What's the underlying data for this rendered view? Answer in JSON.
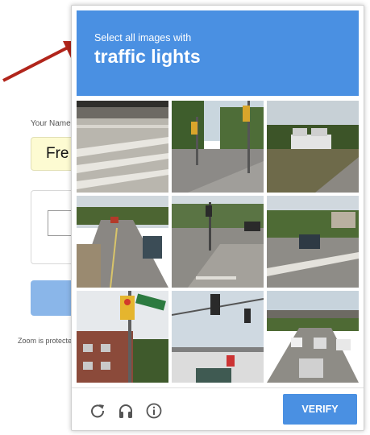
{
  "background_form": {
    "name_label": "Your Name",
    "name_value": "Fre",
    "zoom_text": "Zoom is protected"
  },
  "captcha": {
    "instruction": "Select all images with",
    "target": "traffic lights",
    "verify_label": "VERIFY",
    "footer_icons": [
      "reload-icon",
      "headphones-icon",
      "info-icon"
    ],
    "tiles": [
      "crosswalk street",
      "intersection with traffic light",
      "car carrier truck on highway",
      "road with car and dumpster",
      "street with traffic lights",
      "road with car on right",
      "traffic light and street sign",
      "traffic light on pole",
      "highway traffic under bridge"
    ],
    "colors": {
      "accent": "#4a90e2",
      "arrow": "#b1251b"
    }
  }
}
